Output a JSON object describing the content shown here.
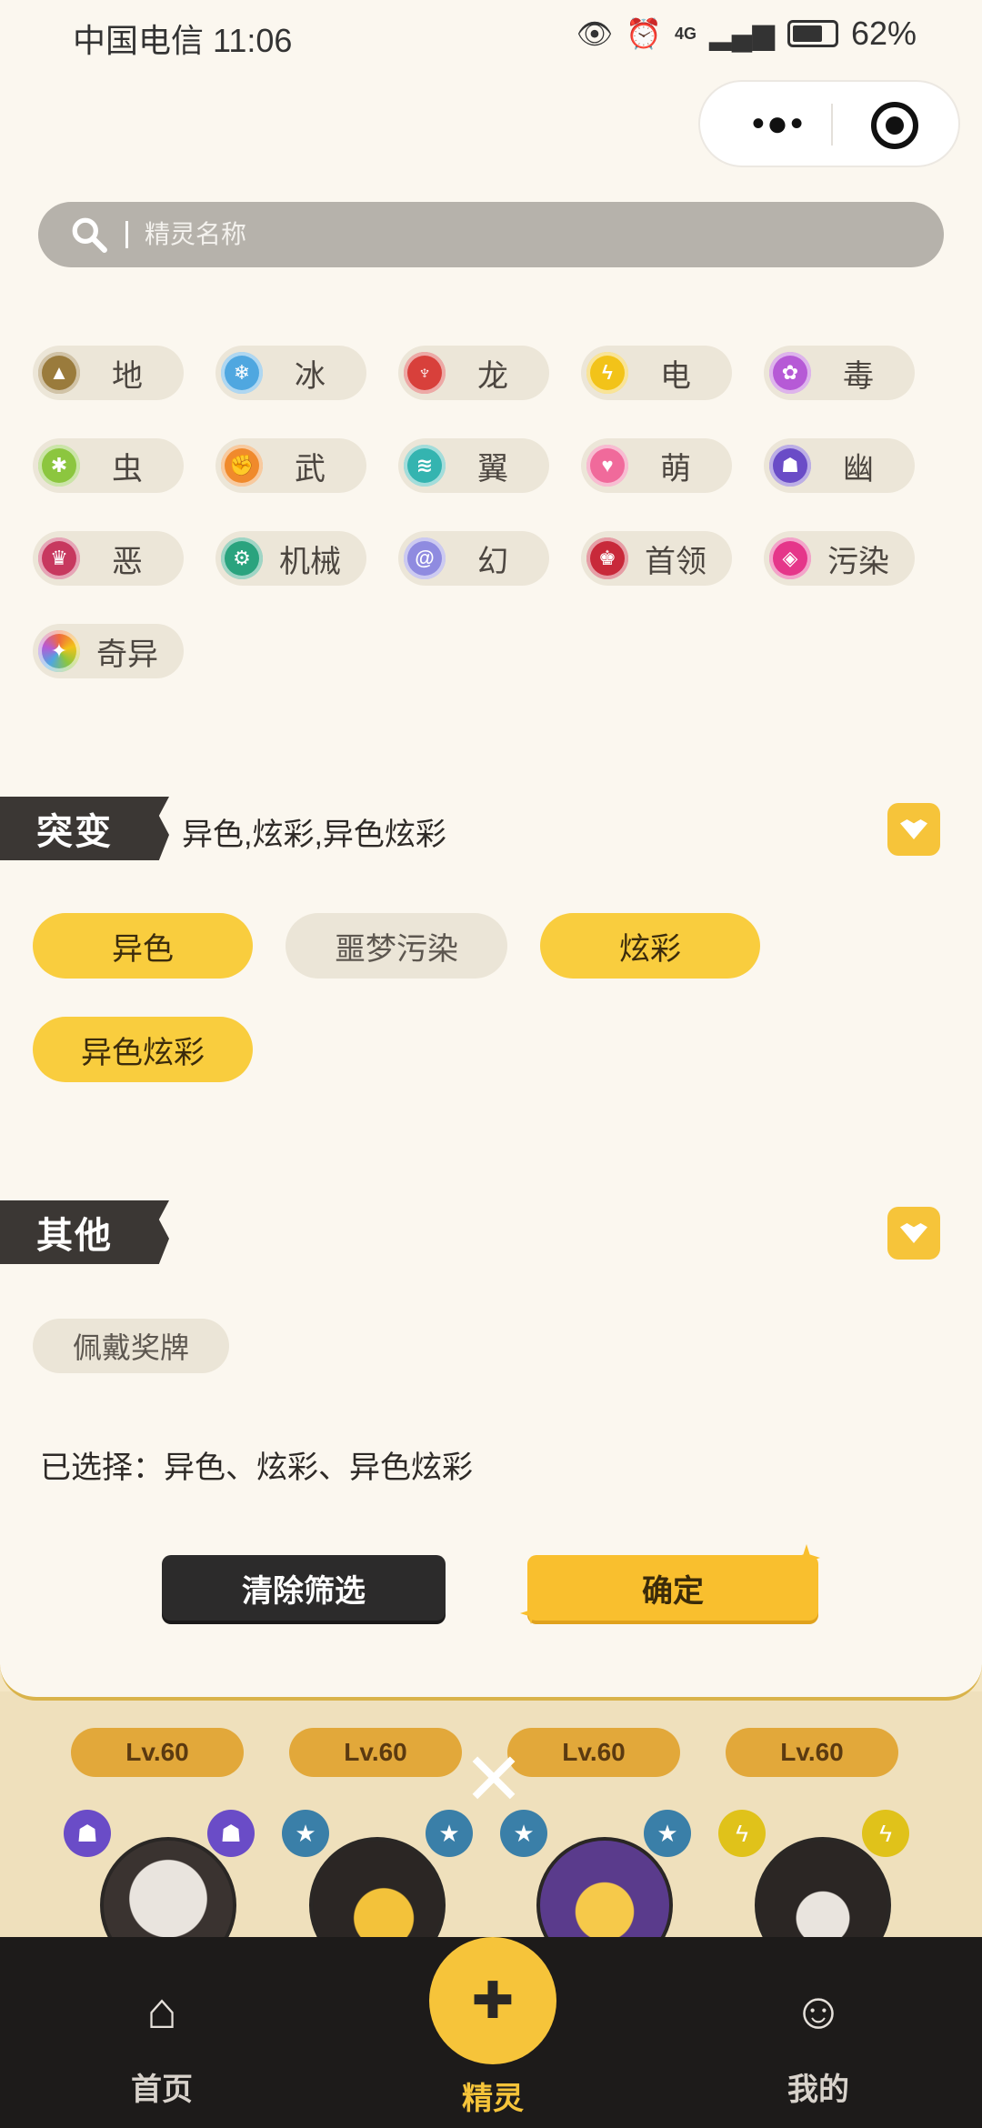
{
  "status_bar": {
    "carrier": "中国电信",
    "time": "11:06",
    "network": "4G",
    "battery": "62%"
  },
  "capsule": {
    "more_icon": "more-dots-icon",
    "close_icon": "target-circle-icon"
  },
  "search": {
    "placeholder": "精灵名称"
  },
  "types": [
    {
      "label": "地",
      "color": "#9a7b3c",
      "icon": "mountain-icon"
    },
    {
      "label": "冰",
      "color": "#4fa7e0",
      "icon": "snowflake-icon"
    },
    {
      "label": "龙",
      "color": "#d8403b",
      "icon": "dragon-icon"
    },
    {
      "label": "电",
      "color": "#f2c319",
      "icon": "lightning-icon"
    },
    {
      "label": "毒",
      "color": "#b65ad6",
      "icon": "poison-icon"
    },
    {
      "label": "虫",
      "color": "#8cc63f",
      "icon": "bug-icon"
    },
    {
      "label": "武",
      "color": "#f08a2c",
      "icon": "fist-icon"
    },
    {
      "label": "翼",
      "color": "#34b4b0",
      "icon": "wing-icon"
    },
    {
      "label": "萌",
      "color": "#f06a9b",
      "icon": "heart-icon"
    },
    {
      "label": "幽",
      "color": "#6a4cc7",
      "icon": "ghost-icon"
    },
    {
      "label": "恶",
      "color": "#c7385f",
      "icon": "demon-icon"
    },
    {
      "label": "机械",
      "color": "#2aa37e",
      "icon": "gear-icon"
    },
    {
      "label": "幻",
      "color": "#8f8be0",
      "icon": "swirl-icon"
    },
    {
      "label": "首领",
      "color": "#c8293a",
      "icon": "crown-icon"
    },
    {
      "label": "污染",
      "color": "#e5368a",
      "icon": "pollution-icon"
    },
    {
      "label": "奇异",
      "color": "#f06a3c",
      "icon": "rainbow-icon"
    }
  ],
  "mutation": {
    "title": "突变",
    "value": "异色,炫彩,异色炫彩",
    "options": [
      {
        "label": "异色",
        "selected": true
      },
      {
        "label": "噩梦污染",
        "selected": false
      },
      {
        "label": "炫彩",
        "selected": true
      },
      {
        "label": "异色炫彩",
        "selected": true
      }
    ]
  },
  "other": {
    "title": "其他",
    "options": [
      {
        "label": "佩戴奖牌",
        "selected": false
      }
    ]
  },
  "selected_summary": "已选择：异色、炫彩、异色炫彩",
  "buttons": {
    "clear": "清除筛选",
    "confirm": "确定"
  },
  "background_list": {
    "levels": [
      "Lv.60",
      "Lv.60",
      "Lv.60",
      "Lv.60"
    ]
  },
  "bottom_nav": {
    "home": "首页",
    "sprite": "精灵",
    "mine": "我的"
  }
}
